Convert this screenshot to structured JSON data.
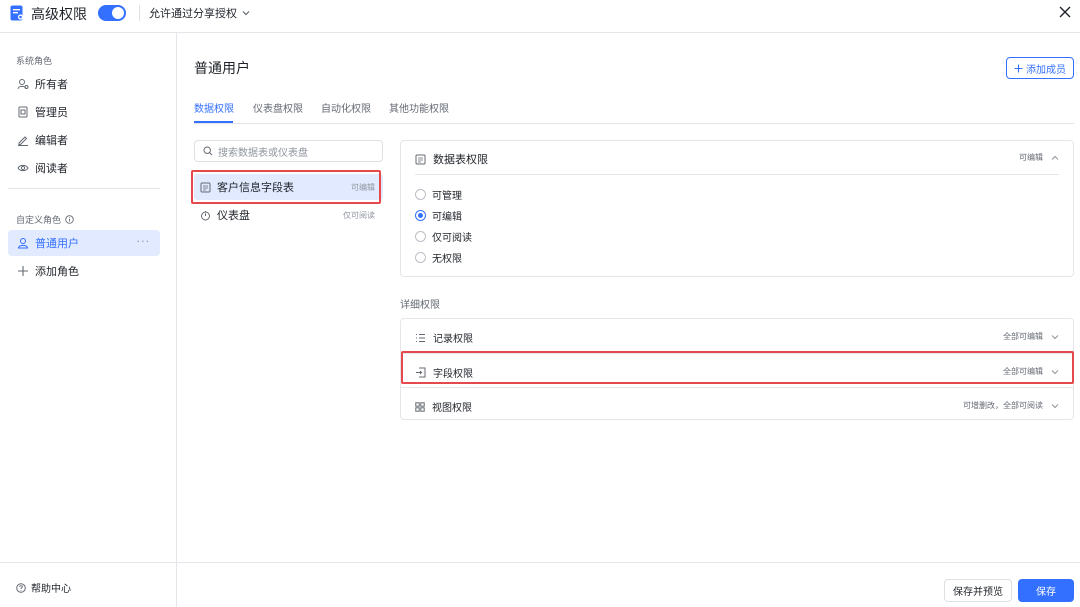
{
  "topbar": {
    "app_icon": "permission-doc-icon",
    "title": "高级权限",
    "toggle_on": true,
    "share_label": "允许通过分享授权",
    "close_icon": "close-icon"
  },
  "sidebar": {
    "system_roles_title": "系统角色",
    "system_roles": [
      {
        "label": "所有者",
        "icon": "owner-icon"
      },
      {
        "label": "管理员",
        "icon": "admin-icon"
      },
      {
        "label": "编辑者",
        "icon": "pencil-icon"
      },
      {
        "label": "阅读者",
        "icon": "eye-icon"
      }
    ],
    "custom_roles_title": "自定义角色",
    "custom_roles": [
      {
        "label": "普通用户",
        "icon": "user-icon",
        "active": true,
        "more": "···"
      }
    ],
    "add_role_label": "添加角色",
    "help_label": "帮助中心"
  },
  "main": {
    "title": "普通用户",
    "add_member_label": "添加成员",
    "tabs": [
      {
        "label": "数据权限",
        "active": true
      },
      {
        "label": "仪表盘权限"
      },
      {
        "label": "自动化权限"
      },
      {
        "label": "其他功能权限"
      }
    ],
    "search_placeholder": "搜索数据表或仪表盘",
    "list": [
      {
        "label": "客户信息字段表",
        "tag": "可编辑",
        "icon": "table-icon",
        "selected": true
      },
      {
        "label": "仪表盘",
        "tag": "仅可阅读",
        "icon": "dashboard-icon"
      }
    ]
  },
  "panel": {
    "table_perm": {
      "title": "数据表权限",
      "value": "可编辑",
      "options": [
        {
          "label": "可管理",
          "selected": false
        },
        {
          "label": "可编辑",
          "selected": true
        },
        {
          "label": "仅可阅读",
          "selected": false
        },
        {
          "label": "无权限",
          "selected": false
        }
      ]
    },
    "detail_title": "详细权限",
    "details": [
      {
        "label": "记录权限",
        "value": "全部可编辑",
        "icon": "list-icon"
      },
      {
        "label": "字段权限",
        "value": "全部可编辑",
        "icon": "field-icon"
      },
      {
        "label": "视图权限",
        "value": "可增删改，全部可阅读",
        "icon": "grid-icon"
      }
    ]
  },
  "footer": {
    "preview_label": "保存并预览",
    "save_label": "保存"
  },
  "colors": {
    "accent": "#3370ff",
    "highlight": "#e5484d",
    "selected_bg": "#e1eaff"
  }
}
